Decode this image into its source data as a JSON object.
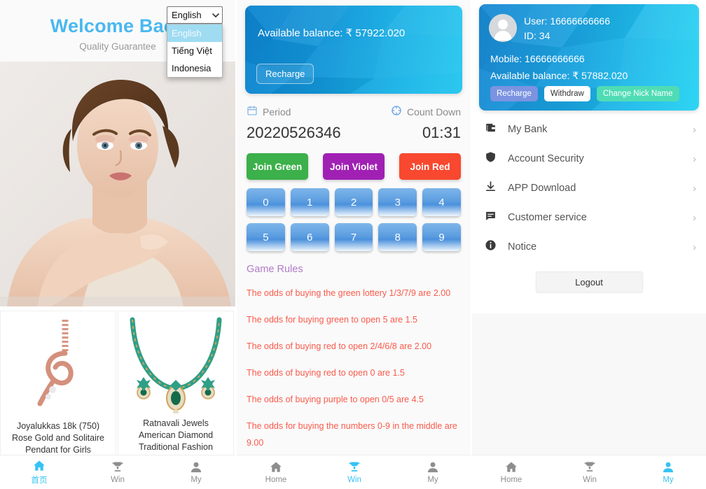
{
  "panel1": {
    "title": "Welcome Back",
    "subtitle": "Quality Guarantee",
    "language": {
      "selected": "English",
      "icon": "chevron-down-icon",
      "options": [
        "English",
        "Tiếng Việt",
        "Indonesia"
      ]
    },
    "hero_alt": "woman-portrait-jewellery-banner",
    "products": [
      {
        "caption": "Joyalukkas 18k (750) Rose Gold and Solitaire Pendant for Girls",
        "thumb": "rose-gold-pendant"
      },
      {
        "caption": "Ratnavali Jewels American Diamond Traditional Fashion Jewellery Green",
        "thumb": "green-necklace-set"
      }
    ],
    "tabs": [
      {
        "label": "首页",
        "icon": "home-icon",
        "active": true
      },
      {
        "label": "Win",
        "icon": "trophy-icon",
        "active": false
      },
      {
        "label": "My",
        "icon": "person-icon",
        "active": false
      }
    ]
  },
  "panel2": {
    "balance_card": {
      "balance_label": "Available balance: ₹ 57922.020",
      "recharge_label": "Recharge"
    },
    "period": {
      "label": "Period",
      "icon": "calendar-icon",
      "value": "20220526346"
    },
    "countdown": {
      "label": "Count Down",
      "icon": "timer-icon",
      "value": "01:31"
    },
    "joins": [
      {
        "label": "Join Green",
        "color": "#3cb04a"
      },
      {
        "label": "Join Violet",
        "color": "#a020b4"
      },
      {
        "label": "Join Red",
        "color": "#f8482f"
      }
    ],
    "numbers": [
      "0",
      "1",
      "2",
      "3",
      "4",
      "5",
      "6",
      "7",
      "8",
      "9"
    ],
    "rules_heading": "Game Rules",
    "rules": [
      "The odds of buying the green lottery 1/3/7/9 are 2.00",
      "The odds for buying green to open 5 are 1.5",
      "The odds of buying red to open 2/4/6/8 are 2.00",
      "The odds of buying red to open 0 are 1.5",
      "The odds of buying purple to open 0/5 are 4.5",
      "The odds for buying the numbers 0-9 in the middle are 9.00"
    ],
    "tabs": [
      {
        "label": "Home",
        "icon": "home-icon",
        "active": false
      },
      {
        "label": "Win",
        "icon": "trophy-icon",
        "active": true
      },
      {
        "label": "My",
        "icon": "person-icon",
        "active": false
      }
    ]
  },
  "panel3": {
    "user_card": {
      "avatar": "avatar-placeholder-icon",
      "user": "User: 16666666666",
      "id": "ID: 34",
      "mobile": "Mobile: 16666666666",
      "balance": "Available balance: ₹ 57882.020",
      "buttons": [
        {
          "label": "Recharge",
          "style": "recharge"
        },
        {
          "label": "Withdraw",
          "style": "withdraw"
        },
        {
          "label": "Change Nick Name",
          "style": "nick"
        }
      ]
    },
    "menu": [
      {
        "label": "My Bank",
        "icon": "wallet-icon"
      },
      {
        "label": "Account Security",
        "icon": "shield-icon"
      },
      {
        "label": "APP Download",
        "icon": "download-icon"
      },
      {
        "label": "Customer service",
        "icon": "chat-icon"
      },
      {
        "label": "Notice",
        "icon": "info-icon"
      }
    ],
    "chevron": "›",
    "logout_label": "Logout",
    "tabs": [
      {
        "label": "Home",
        "icon": "home-icon",
        "active": false
      },
      {
        "label": "Win",
        "icon": "trophy-icon",
        "active": false
      },
      {
        "label": "My",
        "icon": "person-icon",
        "active": true
      }
    ]
  },
  "colors": {
    "accent": "#35c3f3",
    "title": "#4ab8f0",
    "rule_text": "#fa5a4b",
    "rules_heading": "#b07cc6"
  }
}
